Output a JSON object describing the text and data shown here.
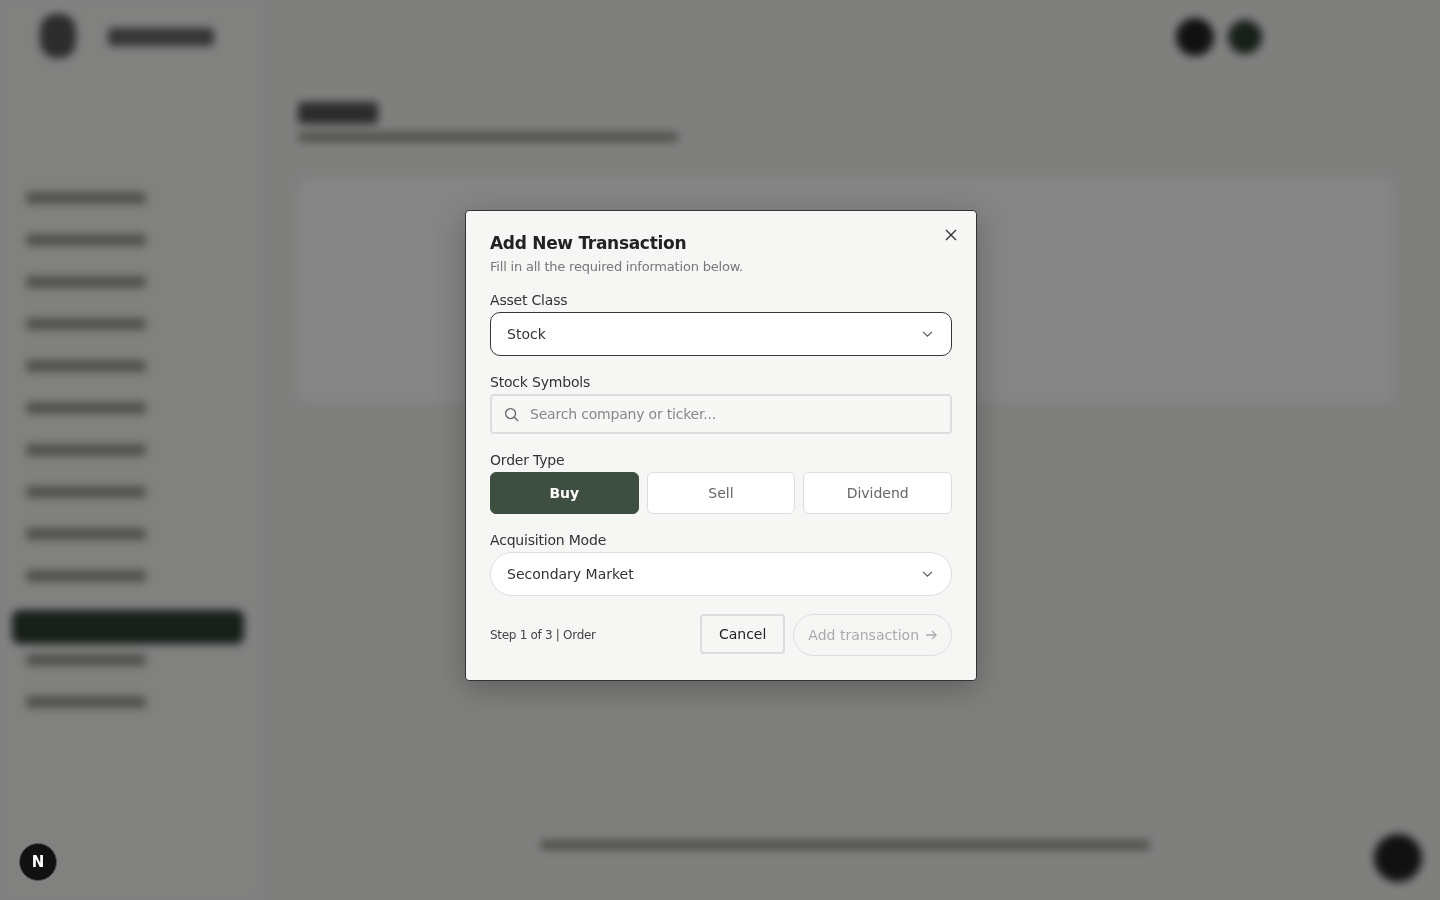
{
  "dialog": {
    "title": "Add New Transaction",
    "subtitle": "Fill in all the required information below.",
    "asset_class": {
      "label": "Asset Class",
      "value": "Stock"
    },
    "stock_symbols": {
      "label": "Stock Symbols",
      "placeholder": "Search company or ticker..."
    },
    "order_type": {
      "label": "Order Type",
      "options": [
        {
          "label": "Buy",
          "selected": true
        },
        {
          "label": "Sell",
          "selected": false
        },
        {
          "label": "Dividend",
          "selected": false
        }
      ]
    },
    "acquisition_mode": {
      "label": "Acquisition Mode",
      "value": "Secondary Market"
    },
    "step": "Step 1 of 3 | Order",
    "buttons": [
      {
        "label": "Cancel",
        "kind": "cancel",
        "disabled": false
      },
      {
        "label": "Add transaction",
        "kind": "submit",
        "disabled": true
      }
    ]
  },
  "dev_badge": "N"
}
